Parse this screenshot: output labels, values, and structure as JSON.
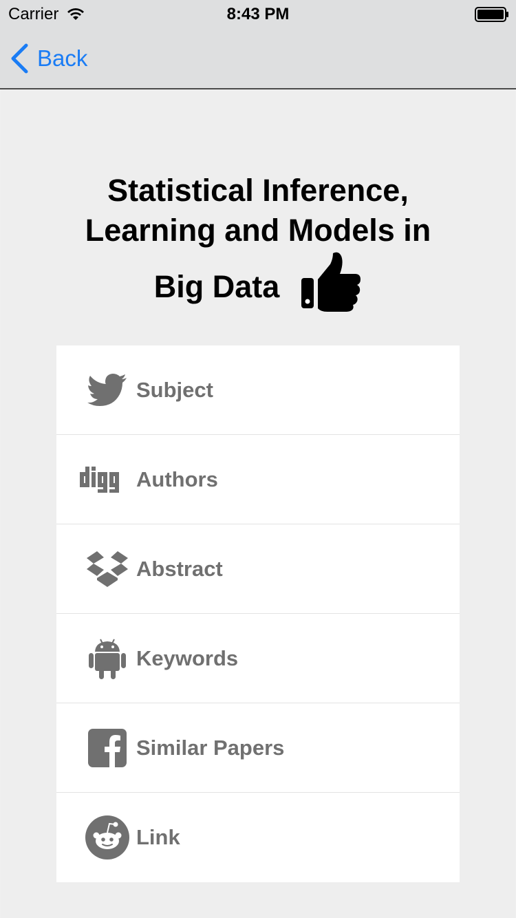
{
  "status_bar": {
    "carrier": "Carrier",
    "time": "8:43 PM"
  },
  "nav": {
    "back_label": "Back"
  },
  "title": {
    "line1": "Statistical Inference,",
    "line2": "Learning and Models in",
    "line3": "Big Data"
  },
  "menu": {
    "items": [
      {
        "label": "Subject",
        "icon": "twitter-icon"
      },
      {
        "label": "Authors",
        "icon": "digg-icon"
      },
      {
        "label": "Abstract",
        "icon": "dropbox-icon"
      },
      {
        "label": "Keywords",
        "icon": "android-icon"
      },
      {
        "label": "Similar Papers",
        "icon": "facebook-icon"
      },
      {
        "label": "Link",
        "icon": "reddit-icon"
      }
    ]
  },
  "colors": {
    "accent": "#1a7cf5",
    "icon_gray": "#707070",
    "background": "#eeeeee"
  }
}
